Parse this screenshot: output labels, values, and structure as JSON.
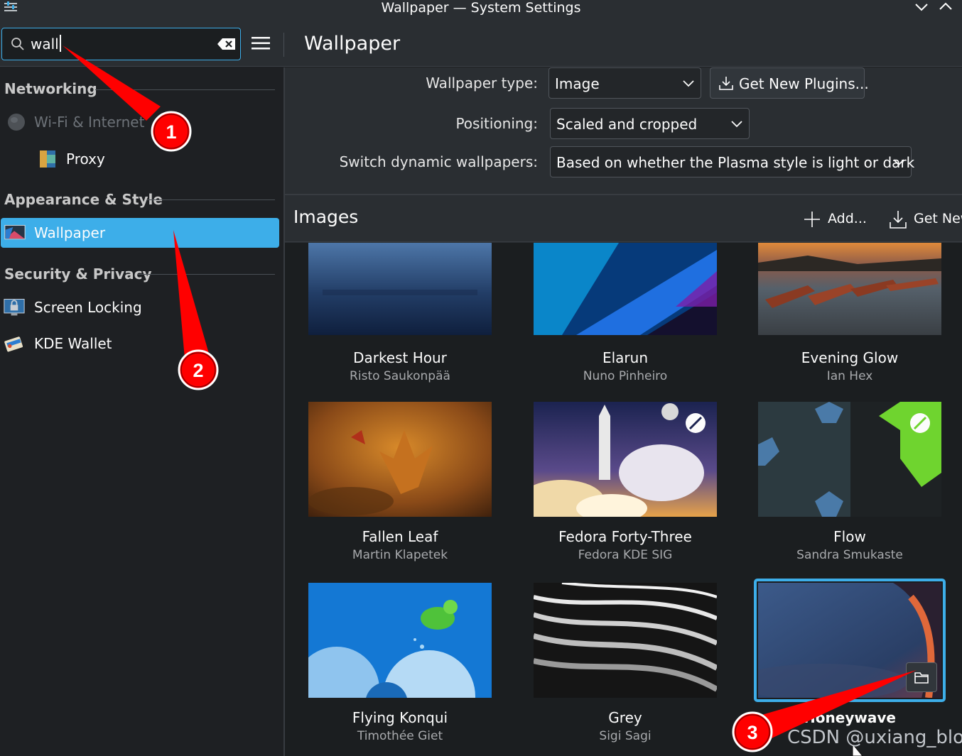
{
  "window": {
    "title": "Wallpaper — System Settings"
  },
  "search": {
    "value": "wall"
  },
  "page_title": "Wallpaper",
  "sidebar": {
    "sections": [
      {
        "title": "Networking"
      },
      {
        "title": "Appearance & Style"
      },
      {
        "title": "Security & Privacy"
      }
    ],
    "items": [
      {
        "label": "Wi-Fi & Internet",
        "icon": "globe-icon",
        "disabled": true
      },
      {
        "label": "Proxy",
        "icon": "proxy-icon"
      },
      {
        "label": "Wallpaper",
        "icon": "wallpaper-icon",
        "active": true
      },
      {
        "label": "Screen Locking",
        "icon": "screen-lock-icon"
      },
      {
        "label": "KDE Wallet",
        "icon": "wallet-icon"
      }
    ]
  },
  "settings": {
    "wallpaper_type": {
      "label": "Wallpaper type:",
      "value": "Image"
    },
    "get_plugins": {
      "label": "Get New Plugins..."
    },
    "positioning": {
      "label": "Positioning:",
      "value": "Scaled and cropped"
    },
    "dynamic": {
      "label": "Switch dynamic wallpapers:",
      "value": "Based on whether the Plasma style is light or dark"
    }
  },
  "images": {
    "title": "Images",
    "add_label": "Add...",
    "get_new_label": "Get New",
    "items": [
      {
        "name": "Darkest Hour",
        "author": "Risto Saukonpää"
      },
      {
        "name": "Elarun",
        "author": "Nuno Pinheiro"
      },
      {
        "name": "Evening Glow",
        "author": "Ian Hex"
      },
      {
        "name": "Fallen Leaf",
        "author": "Martin Klapetek"
      },
      {
        "name": "Fedora Forty-Three",
        "author": "Fedora KDE SIG"
      },
      {
        "name": "Flow",
        "author": "Sandra Smukaste"
      },
      {
        "name": "Flying Konqui",
        "author": "Timothée Giet"
      },
      {
        "name": "Grey",
        "author": "Sigi Sagi"
      },
      {
        "name": "Honeywave",
        "author": "",
        "selected": true
      }
    ]
  },
  "annotations": [
    "1",
    "2",
    "3"
  ],
  "watermark": "CSDN @uxiang_blog",
  "colors": {
    "accent": "#3daee9",
    "annotation": "#ff0000"
  }
}
